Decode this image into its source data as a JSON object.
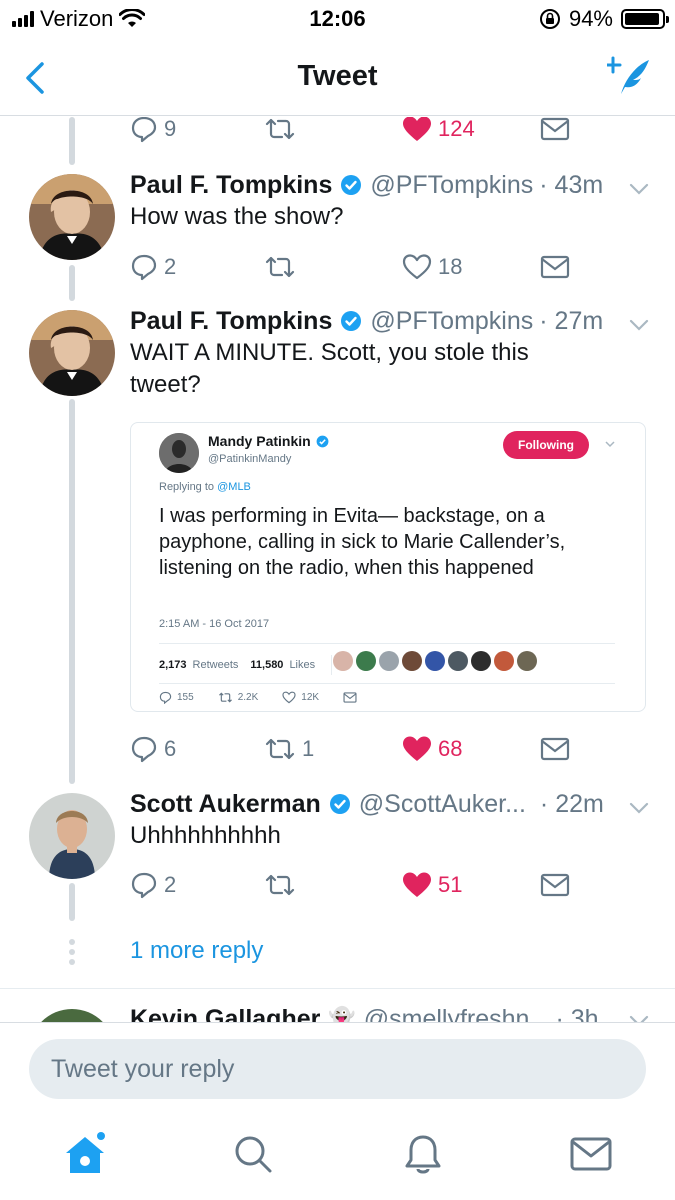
{
  "status_bar": {
    "carrier": "Verizon",
    "time": "12:06",
    "battery_percent": "94%",
    "battery_level": 0.94
  },
  "nav": {
    "title": "Tweet"
  },
  "top_actions": {
    "replies": "9",
    "retweets": "",
    "likes": "124"
  },
  "tweets": [
    {
      "name": "Paul F. Tompkins",
      "handle": "@PFTompkins",
      "time": "· 43m",
      "text": "How was the show?",
      "replies": "2",
      "retweets": "",
      "likes": "18",
      "liked": false
    },
    {
      "name": "Paul F. Tompkins",
      "handle": "@PFTompkins",
      "time": "· 27m",
      "text": "WAIT A MINUTE. Scott, you stole this tweet?",
      "replies": "6",
      "retweets": "1",
      "likes": "68",
      "liked": true,
      "embed": {
        "name": "Mandy Patinkin",
        "handle": "@PatinkinMandy",
        "follow_label": "Following",
        "replying_prefix": "Replying to",
        "replying_to": "@MLB",
        "text": "I was performing in Evita— backstage, on a payphone, calling in sick to Marie Callender’s, listening on the radio, when this happened",
        "date": "2:15 AM - 16 Oct 2017",
        "retweets": "2,173",
        "retweets_label": "Retweets",
        "likes": "11,580",
        "likes_label": "Likes",
        "replies_count": "155",
        "retweets_count": "2.2K",
        "likes_count": "12K"
      }
    },
    {
      "name": "Scott Aukerman",
      "handle": "@ScottAuker...",
      "time": " · 22m",
      "text": "Uhhhhhhhhhh",
      "replies": "2",
      "retweets": "",
      "likes": "51",
      "liked": true
    }
  ],
  "more_reply": "1 more reply",
  "next_tweet": {
    "name": "Kevin Gallagher",
    "handle": "@smellyfreshn",
    "time": "· 3h"
  },
  "composer": {
    "placeholder": "Tweet your reply"
  },
  "colors": {
    "accent": "#1b95e0",
    "like": "#e0245e",
    "muted": "#657786"
  },
  "tabs": [
    "home-icon",
    "search-icon",
    "notifications-icon",
    "messages-icon"
  ]
}
